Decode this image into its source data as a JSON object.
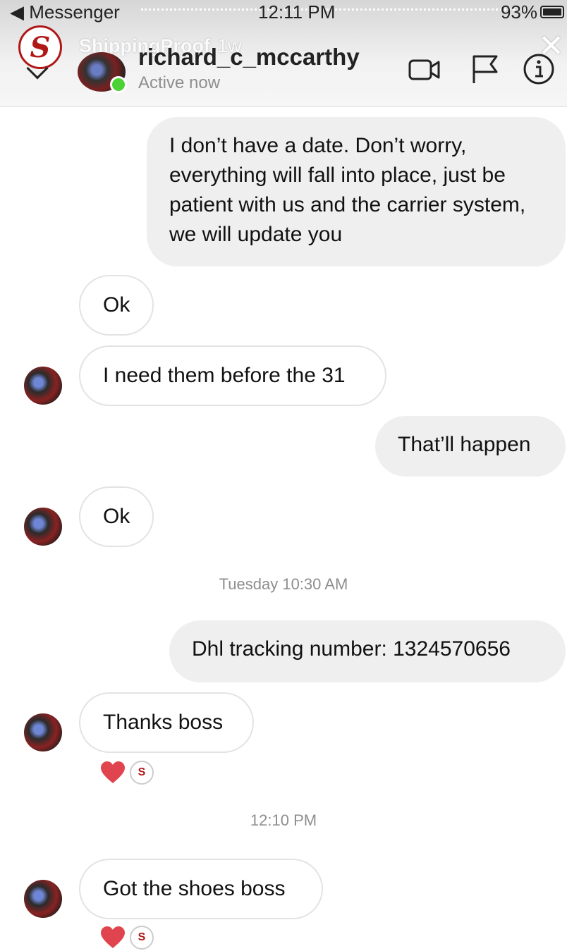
{
  "status_bar": {
    "carrier": "◀ Messenger",
    "time": "12:11 PM",
    "battery": "93%"
  },
  "story": {
    "account": "ShippingProof",
    "age": "1w",
    "avatar_letter": "S"
  },
  "thread_header": {
    "name": "richard_c_mccarthy",
    "status": "Active now",
    "icons": [
      "back-icon",
      "video-call-icon",
      "flag-icon",
      "info-icon"
    ]
  },
  "messages": [
    {
      "id": "m1",
      "sender": "me",
      "text": "I don’t have a date. Don’t worry, everything will fall into place, just be patient with us and the carrier system, we will update you"
    },
    {
      "id": "m2",
      "sender": "them",
      "text": "Ok"
    },
    {
      "id": "m3",
      "sender": "them",
      "text": "I need them before the 31"
    },
    {
      "id": "m4",
      "sender": "me",
      "text": "That’ll happen"
    },
    {
      "id": "m5",
      "sender": "them",
      "text": "Ok"
    },
    {
      "id": "ts1",
      "type": "timestamp",
      "text": "Tuesday 10:30 AM"
    },
    {
      "id": "m6",
      "sender": "me",
      "text": "Dhl tracking number: 1324570656"
    },
    {
      "id": "m7",
      "sender": "them",
      "text": "Thanks boss",
      "reactions": [
        "heart-icon",
        "reactor-avatar"
      ]
    },
    {
      "id": "ts2",
      "type": "timestamp",
      "text": "12:10 PM"
    },
    {
      "id": "m8",
      "sender": "them",
      "text": "Got the shoes boss",
      "reactions": [
        "heart-icon",
        "reactor-avatar"
      ]
    }
  ],
  "colors": {
    "outgoing_bubble": "#efefef",
    "incoming_border": "#e3e3e3",
    "online": "#4cd137",
    "heart": "#e0454f",
    "muted_text": "#8e8e8e"
  }
}
